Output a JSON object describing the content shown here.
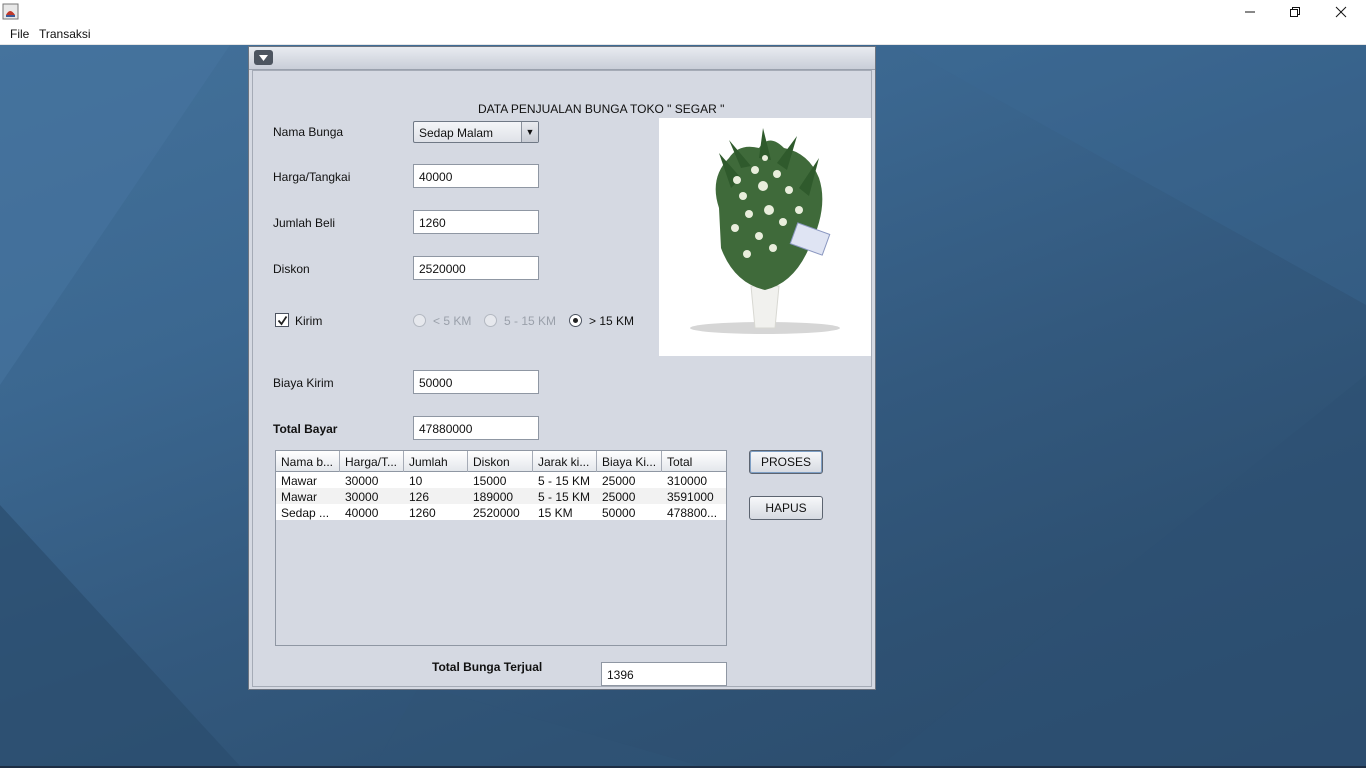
{
  "window": {
    "menu": [
      "File",
      "Transaksi"
    ]
  },
  "form": {
    "heading": "DATA PENJUALAN BUNGA TOKO \" SEGAR \"",
    "nama_bunga_label": "Nama Bunga",
    "nama_bunga_value": "Sedap Malam",
    "harga_label": "Harga/Tangkai",
    "harga_value": "40000",
    "jumlah_label": "Jumlah Beli",
    "jumlah_value": "1260",
    "diskon_label": "Diskon",
    "diskon_value": "2520000",
    "kirim_label": "Kirim",
    "kirim_checked": true,
    "jarak_options": [
      "< 5 KM",
      "5 - 15 KM",
      "> 15 KM"
    ],
    "jarak_selected": "> 15 KM",
    "biaya_label": "Biaya Kirim",
    "biaya_value": "50000",
    "total_label": "Total Bayar",
    "total_value": "47880000",
    "terjual_label": "Total Bunga Terjual",
    "terjual_value": "1396"
  },
  "buttons": {
    "proses": "PROSES",
    "hapus": "HAPUS"
  },
  "table": {
    "headers": [
      "Nama b...",
      "Harga/T...",
      "Jumlah",
      "Diskon",
      "Jarak ki...",
      "Biaya Ki...",
      "Total"
    ],
    "rows": [
      [
        "Mawar",
        "30000",
        "10",
        "15000",
        "5 - 15 KM",
        "25000",
        "310000"
      ],
      [
        "Mawar",
        "30000",
        "126",
        "189000",
        "5 - 15 KM",
        "25000",
        "3591000"
      ],
      [
        "Sedap ...",
        "40000",
        "1260",
        "2520000",
        "15 KM",
        "50000",
        "478800..."
      ]
    ]
  },
  "colors": {
    "desktop": "#3b6790",
    "frame_bg": "#d5d9e2"
  }
}
